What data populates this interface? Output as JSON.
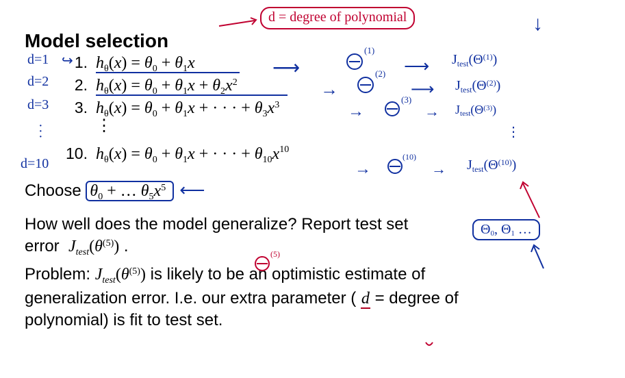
{
  "title": "Model selection",
  "degrees": {
    "d1": "d=1",
    "d2": "d=2",
    "d3": "d=3",
    "d10": "d=10"
  },
  "models": {
    "n1": "1.",
    "n2": "2.",
    "n3": "3.",
    "n10": "10.",
    "line1": "hθ(x) = θ0 + θ1x",
    "line2": "hθ(x) = θ0 + θ1x + θ2x2",
    "line3": "hθ(x) = θ0 + θ1x + · · · + θ3x3",
    "line10": "hθ(x) = θ0 + θ1x + · · · + θ10x10"
  },
  "thetas": {
    "t1": "Θ",
    "s1": "(1)",
    "t2": "Θ",
    "s2": "(2)",
    "t3": "Θ",
    "s3": "(3)",
    "t10": "Θ",
    "s10": "(10)"
  },
  "jtest": {
    "j1": "Jtest(Θ(1))",
    "j2": "Jtest(Θ(2))",
    "j3": "Jtest(Θ(3))",
    "j10": "Jtest(Θ(10))"
  },
  "box_d": "d = degree of polynomial",
  "theta5_circle": "Θ(5)",
  "choose": {
    "label": "Choose ",
    "expr": "θ0 + … θ5x5"
  },
  "theta_box": "Θ0, Θ1 …",
  "generalize": {
    "q": "How well does the model generalize? Report test set",
    "err": "error  Jtest(θ(5)) ."
  },
  "problem": {
    "label": "Problem:  ",
    "jtest": "Jtest(θ(5))",
    "rest1": " is likely to be an optimistic estimate of",
    "line2a": "generalization error. I.e. our extra parameter ( ",
    "d": "d",
    "line2b": " = degree of",
    "line3": "polynomial) is fit to test set."
  },
  "arrows": {
    "to1": "→",
    "to2": "→",
    "to3": "→",
    "to10": "→",
    "long1": "⟶",
    "long2": "⟶",
    "long3": "⟶",
    "long10": "⟶",
    "hook1": "↪",
    "up": "↑",
    "down": "↓",
    "left": "⟵"
  }
}
